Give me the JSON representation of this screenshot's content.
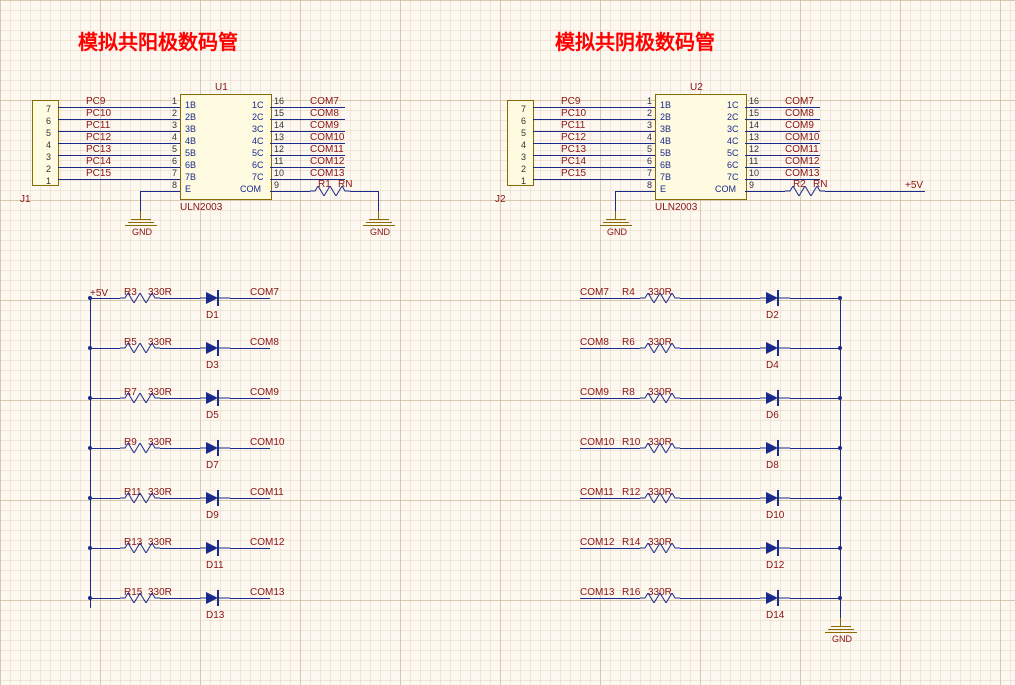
{
  "titles": {
    "left": "模拟共阳极数码管",
    "right": "模拟共阴极数码管"
  },
  "connector_left": {
    "ref": "J1",
    "pins": [
      "7",
      "6",
      "5",
      "4",
      "3",
      "2",
      "1"
    ]
  },
  "connector_right": {
    "ref": "J2",
    "pins": [
      "7",
      "6",
      "5",
      "4",
      "3",
      "2",
      "1"
    ]
  },
  "ic_left": {
    "ref": "U1",
    "part": "ULN2003",
    "left_pins": [
      {
        "n": "1",
        "name": "1B"
      },
      {
        "n": "2",
        "name": "2B"
      },
      {
        "n": "3",
        "name": "3B"
      },
      {
        "n": "4",
        "name": "4B"
      },
      {
        "n": "5",
        "name": "5B"
      },
      {
        "n": "6",
        "name": "6B"
      },
      {
        "n": "7",
        "name": "7B"
      },
      {
        "n": "8",
        "name": "E"
      }
    ],
    "right_pins": [
      {
        "n": "16",
        "name": "1C"
      },
      {
        "n": "15",
        "name": "2C"
      },
      {
        "n": "14",
        "name": "3C"
      },
      {
        "n": "13",
        "name": "4C"
      },
      {
        "n": "12",
        "name": "5C"
      },
      {
        "n": "11",
        "name": "6C"
      },
      {
        "n": "10",
        "name": "7C"
      },
      {
        "n": "9",
        "name": "COM"
      }
    ]
  },
  "ic_right": {
    "ref": "U2",
    "part": "ULN2003"
  },
  "nets_in": [
    "PC9",
    "PC10",
    "PC11",
    "PC12",
    "PC13",
    "PC14",
    "PC15"
  ],
  "nets_out": [
    "COM7",
    "COM8",
    "COM9",
    "COM10",
    "COM11",
    "COM12",
    "COM13"
  ],
  "r1": {
    "ref": "R1",
    "val": "RN"
  },
  "r2": {
    "ref": "R2",
    "val": "RN"
  },
  "gnd_label": "GND",
  "plus5v": "+5V",
  "led_rows_left": [
    {
      "r": "R3",
      "rv": "330R",
      "d": "D1",
      "net": "COM7"
    },
    {
      "r": "R5",
      "rv": "330R",
      "d": "D3",
      "net": "COM8"
    },
    {
      "r": "R7",
      "rv": "330R",
      "d": "D5",
      "net": "COM9"
    },
    {
      "r": "R9",
      "rv": "330R",
      "d": "D7",
      "net": "COM10"
    },
    {
      "r": "R11",
      "rv": "330R",
      "d": "D9",
      "net": "COM11"
    },
    {
      "r": "R13",
      "rv": "330R",
      "d": "D11",
      "net": "COM12"
    },
    {
      "r": "R15",
      "rv": "330R",
      "d": "D13",
      "net": "COM13"
    }
  ],
  "led_rows_right": [
    {
      "r": "R4",
      "rv": "330R",
      "d": "D2",
      "net": "COM7"
    },
    {
      "r": "R6",
      "rv": "330R",
      "d": "D4",
      "net": "COM8"
    },
    {
      "r": "R8",
      "rv": "330R",
      "d": "D6",
      "net": "COM9"
    },
    {
      "r": "R10",
      "rv": "330R",
      "d": "D8",
      "net": "COM10"
    },
    {
      "r": "R12",
      "rv": "330R",
      "d": "D10",
      "net": "COM11"
    },
    {
      "r": "R14",
      "rv": "330R",
      "d": "D12",
      "net": "COM12"
    },
    {
      "r": "R16",
      "rv": "330R",
      "d": "D14",
      "net": "COM13"
    }
  ]
}
